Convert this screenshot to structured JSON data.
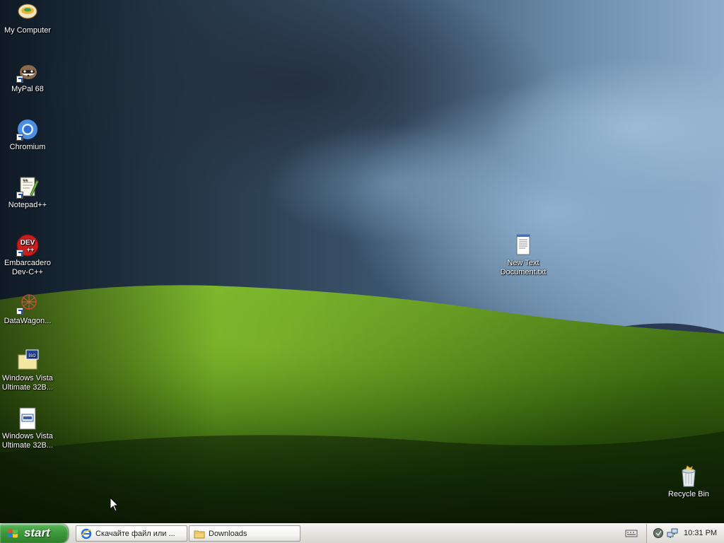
{
  "desktop": {
    "icons": [
      {
        "name": "my-computer",
        "label": "My Computer",
        "icon": "computer-icon"
      },
      {
        "name": "mypal",
        "label": "MyPal 68",
        "icon": "mypal-icon"
      },
      {
        "name": "chromium",
        "label": "Chromium",
        "icon": "chromium-icon"
      },
      {
        "name": "notepadpp",
        "label": "Notepad++",
        "icon": "notepadpp-icon"
      },
      {
        "name": "devcpp",
        "label": "Embarcadero Dev-C++",
        "icon": "devcpp-icon",
        "icon_text": "DEV",
        "icon_subtext": "++"
      },
      {
        "name": "datawagon",
        "label": "DataWagon...",
        "icon": "datawagon-icon"
      },
      {
        "name": "vista-iso",
        "label": "Windows Vista Ultimate 32B...",
        "icon": "iso-file-icon",
        "icon_text": "iso"
      },
      {
        "name": "vista-file",
        "label": "Windows Vista Ultimate 32B...",
        "icon": "file-icon"
      },
      {
        "name": "new-text-doc",
        "label": "New Text Document.txt",
        "icon": "text-document-icon"
      },
      {
        "name": "recycle-bin",
        "label": "Recycle Bin",
        "icon": "recycle-bin-icon"
      }
    ]
  },
  "taskbar": {
    "start_label": "start",
    "tasks": [
      {
        "label": "Скачайте файл или ...",
        "icon": "internet-explorer-icon"
      },
      {
        "label": "Downloads",
        "icon": "folder-icon"
      }
    ],
    "tray": {
      "clock": "10:31 PM",
      "icons": [
        "security-shield-icon",
        "network-icon"
      ]
    },
    "language_icon": "keyboard-icon"
  },
  "colors": {
    "start_green": "#3c9a3a",
    "taskbar": "#e6e5e0",
    "sky_dark": "#1d2833",
    "hill_green": "#5b9a1c"
  }
}
